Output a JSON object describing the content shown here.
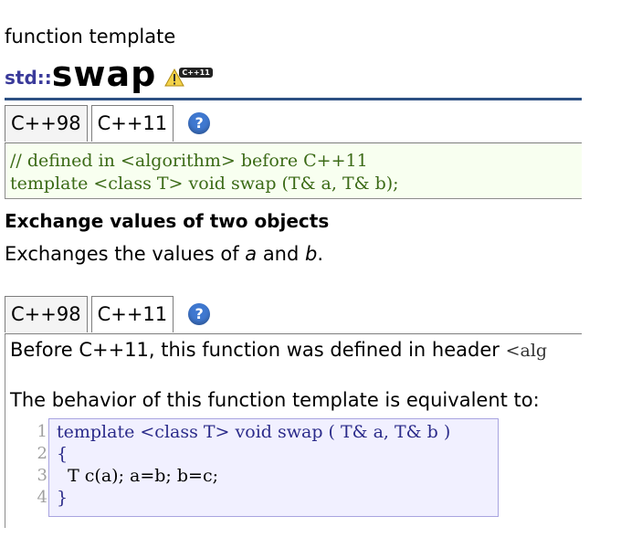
{
  "header": {
    "kind": "function template",
    "namespace": "std::",
    "name": "swap",
    "badge": "C++11"
  },
  "tabs_top": {
    "tabs": [
      "C++98",
      "C++11"
    ],
    "help": "?"
  },
  "declaration": {
    "lines": [
      "// defined in <algorithm> before C++11",
      "template <class T> void swap (T& a, T& b);"
    ]
  },
  "section": {
    "heading": "Exchange values of two objects",
    "desc_prefix": "Exchanges the values of ",
    "desc_a": "a",
    "desc_and": " and ",
    "desc_b": "b",
    "desc_end": "."
  },
  "tabs_bottom": {
    "tabs": [
      "C++98",
      "C++11"
    ],
    "help": "?"
  },
  "detail": {
    "p1_text": "Before C++11, this function was defined in header ",
    "p1_header": "<alg",
    "p2_text": "The behavior of this function template is equivalent to:"
  },
  "code": {
    "line_numbers": [
      "1",
      "2",
      "3",
      "4"
    ],
    "lines": [
      "template <class T> void swap ( T& a, T& b )",
      "{",
      "  T c(a); a=b; b=c;",
      "}"
    ]
  },
  "colors": {
    "rule": "#2d5083",
    "namespace": "#3a3a9a",
    "decl_bg": "#f8fff0",
    "decl_text": "#3b6a16",
    "code_bg": "#f1f0ff",
    "code_border": "#a8a4e0",
    "help_icon": "#3f78d0"
  }
}
